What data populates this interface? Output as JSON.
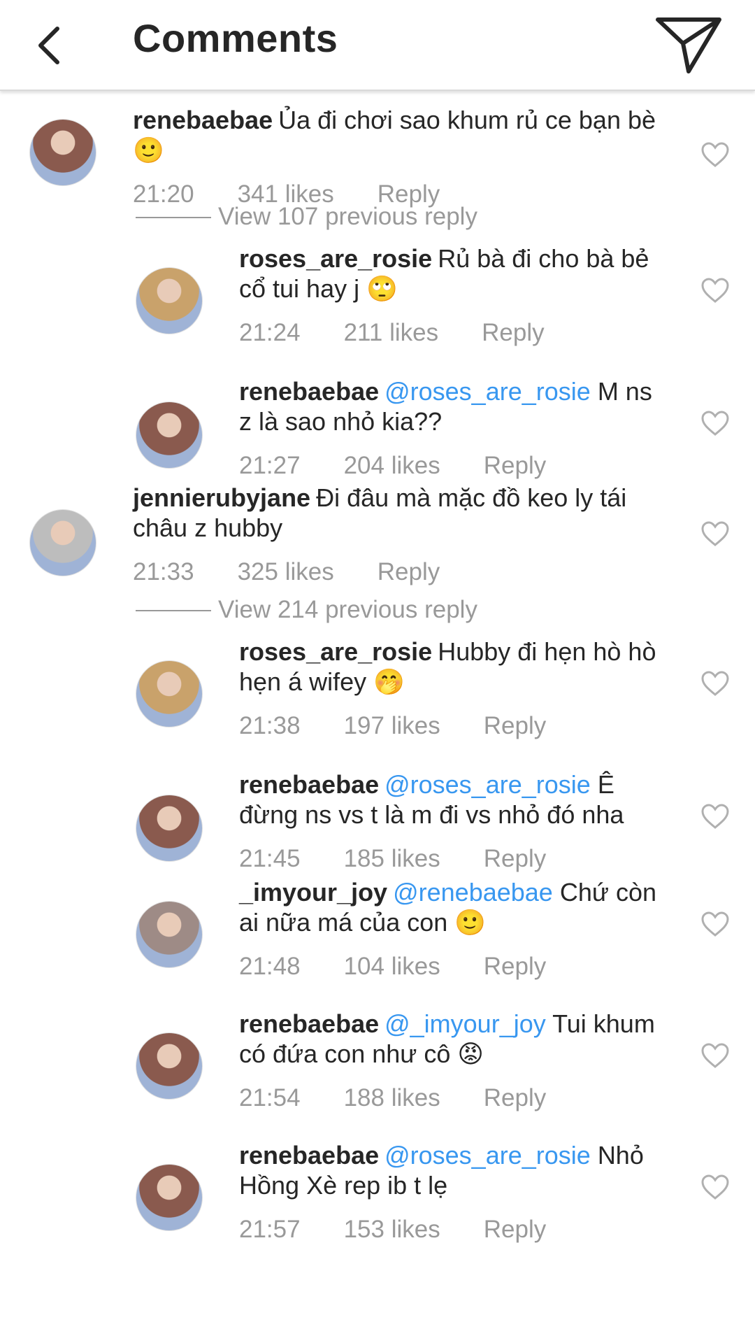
{
  "header": {
    "title": "Comments",
    "back_icon": "chevron-left-icon",
    "send_icon": "paper-plane-icon"
  },
  "comments": [
    {
      "username": "renebaebae",
      "mention": "",
      "text": "Ủa đi chơi sao khum rủ ce bạn bè 🙂",
      "time": "21:20",
      "likes": "341 likes",
      "reply": "Reply",
      "view_replies": "View 107 previous reply",
      "avatar_color": "#8a5a4e",
      "replies": [
        {
          "username": "roses_are_rosie",
          "mention": "",
          "text": "Rủ bà đi cho bà bẻ cổ tui hay j 🙄",
          "time": "21:24",
          "likes": "211 likes",
          "reply": "Reply",
          "avatar_color": "#c9a26b"
        },
        {
          "username": "renebaebae",
          "mention": "@roses_are_rosie",
          "text": "M ns z là sao nhỏ kia??",
          "time": "21:27",
          "likes": "204 likes",
          "reply": "Reply",
          "avatar_color": "#8a5a4e"
        }
      ]
    },
    {
      "username": "jennierubyjane",
      "mention": "",
      "text": "Đi đâu mà mặc đồ keo ly tái châu z hubby",
      "time": "21:33",
      "likes": "325 likes",
      "reply": "Reply",
      "view_replies": "View 214 previous reply",
      "avatar_color": "#bdbdbd",
      "replies": [
        {
          "username": "roses_are_rosie",
          "mention": "",
          "text": "Hubby đi hẹn hò hò hẹn á wifey 🤭",
          "time": "21:38",
          "likes": "197 likes",
          "reply": "Reply",
          "avatar_color": "#c9a26b"
        },
        {
          "username": "renebaebae",
          "mention": "@roses_are_rosie",
          "text": "Ê đừng ns vs t là m đi vs nhỏ đó nha",
          "time": "21:45",
          "likes": "185 likes",
          "reply": "Reply",
          "avatar_color": "#8a5a4e"
        },
        {
          "username": "_imyour_joy",
          "mention": "@renebaebae",
          "text": "Chứ còn ai nữa má của con 🙂",
          "time": "21:48",
          "likes": "104 likes",
          "reply": "Reply",
          "avatar_color": "#9e8b86"
        },
        {
          "username": "renebaebae",
          "mention": "@_imyour_joy",
          "text": "Tui khum có đứa con như cô 😡",
          "time": "21:54",
          "likes": "188 likes",
          "reply": "Reply",
          "avatar_color": "#8a5a4e"
        },
        {
          "username": "renebaebae",
          "mention": "@roses_are_rosie",
          "text": "Nhỏ Hồng Xè rep ib t lẹ",
          "time": "21:57",
          "likes": "153 likes",
          "reply": "Reply",
          "avatar_color": "#8a5a4e"
        }
      ]
    }
  ],
  "colors": {
    "mention": "#3897f0",
    "meta": "#999999",
    "text": "#262626"
  }
}
